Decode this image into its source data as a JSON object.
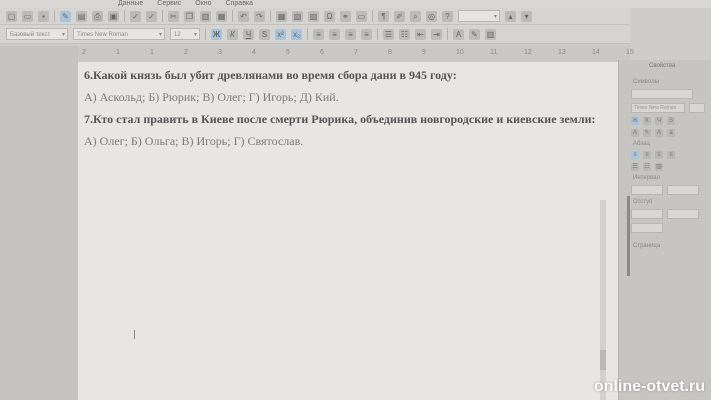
{
  "menu": {
    "items": [
      "Данные",
      "Сервис",
      "Окно",
      "Справка"
    ]
  },
  "toolbar": {
    "paragraph_style": "Базовый текст",
    "font_name": "Times New Roman",
    "font_size": "12",
    "bold_label": "Ж",
    "italic_label": "К",
    "underline_label": "Ч"
  },
  "ruler": {
    "ticks": [
      "2",
      "1",
      "1",
      "2",
      "3",
      "4",
      "5",
      "6",
      "7",
      "8",
      "9",
      "10",
      "11",
      "12",
      "13",
      "14",
      "15"
    ]
  },
  "document": {
    "q6_text": "6.Какой князь был убит древлянами во время сбора дани в 945 году:",
    "q6_answers": "А) Аскольд; Б) Рюрик; В) Олег; Г) Игорь; Д) Кий.",
    "q7_text": "7.Кто стал править в Киеве после смерти Рюрика, объединив новгородские и киевские земли:",
    "q7_answers": "А) Олег; Б) Ольга; В) Игорь; Г) Святослав."
  },
  "sidebar": {
    "title": "Свойства",
    "section_symbols": "Символы",
    "font_field": "Times New Roman",
    "section_paragraph": "Абзац",
    "section_spacing": "Интервал",
    "section_indent": "Отступ",
    "section_page": "Страница"
  },
  "watermark": "online-otvet.ru"
}
